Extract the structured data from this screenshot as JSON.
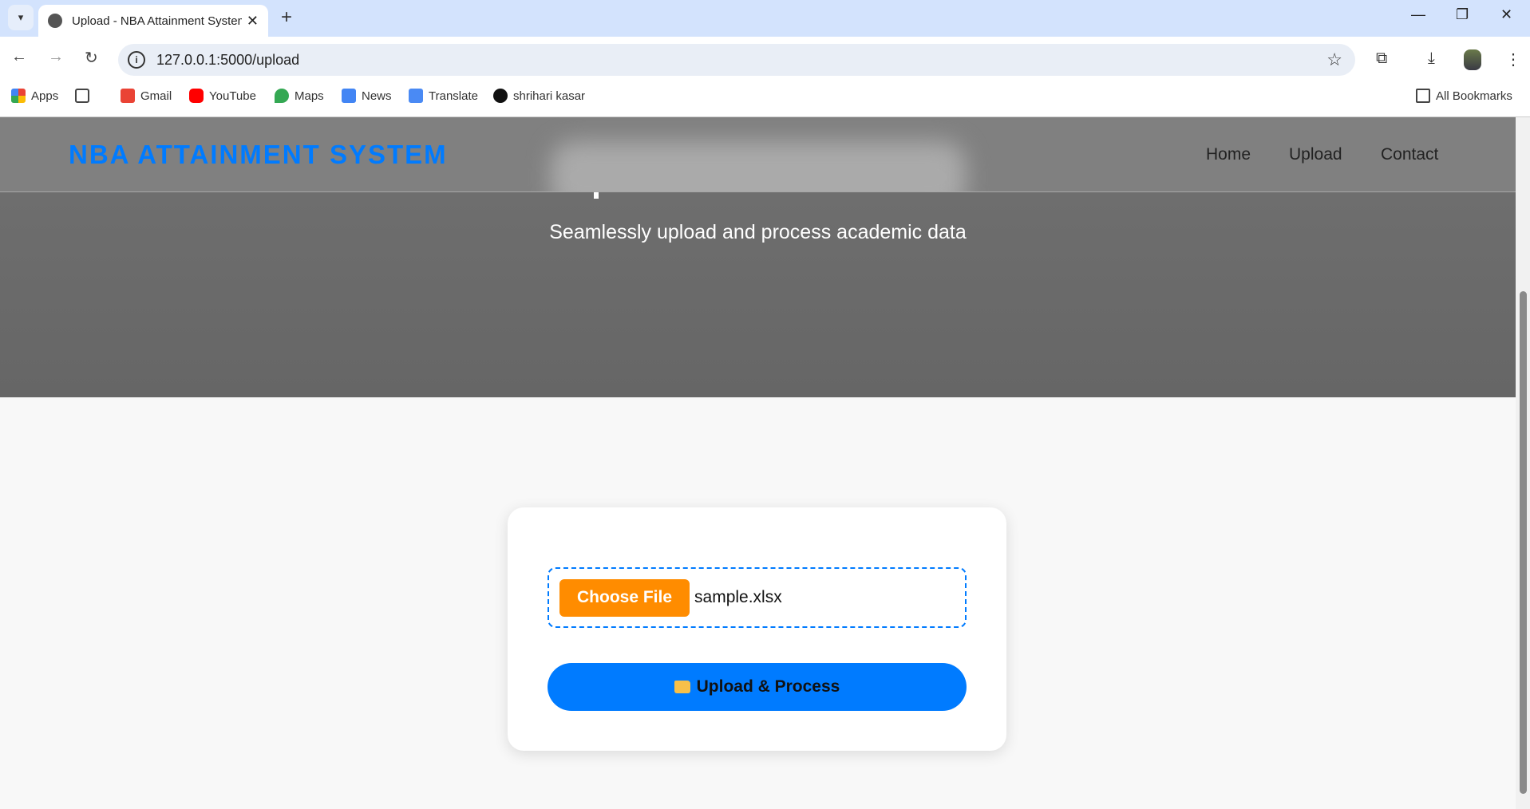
{
  "browser": {
    "tab_title": "Upload - NBA Attainment System",
    "url": "127.0.0.1:5000/upload",
    "bookmarks": [
      "Apps",
      "Gmail",
      "YouTube",
      "Maps",
      "News",
      "Translate",
      "shrihari kasar"
    ],
    "all_bookmarks": "All Bookmarks"
  },
  "header": {
    "brand": "NBA ATTAINMENT SYSTEM",
    "nav": [
      "Home",
      "Upload",
      "Contact"
    ]
  },
  "hero": {
    "subtitle": "Seamlessly upload and process academic data"
  },
  "form": {
    "choose_label": "Choose File",
    "file_name": "sample.xlsx",
    "upload_label": "Upload & Process"
  },
  "colors": {
    "accent": "#007bff",
    "choose": "#ff8c00"
  }
}
